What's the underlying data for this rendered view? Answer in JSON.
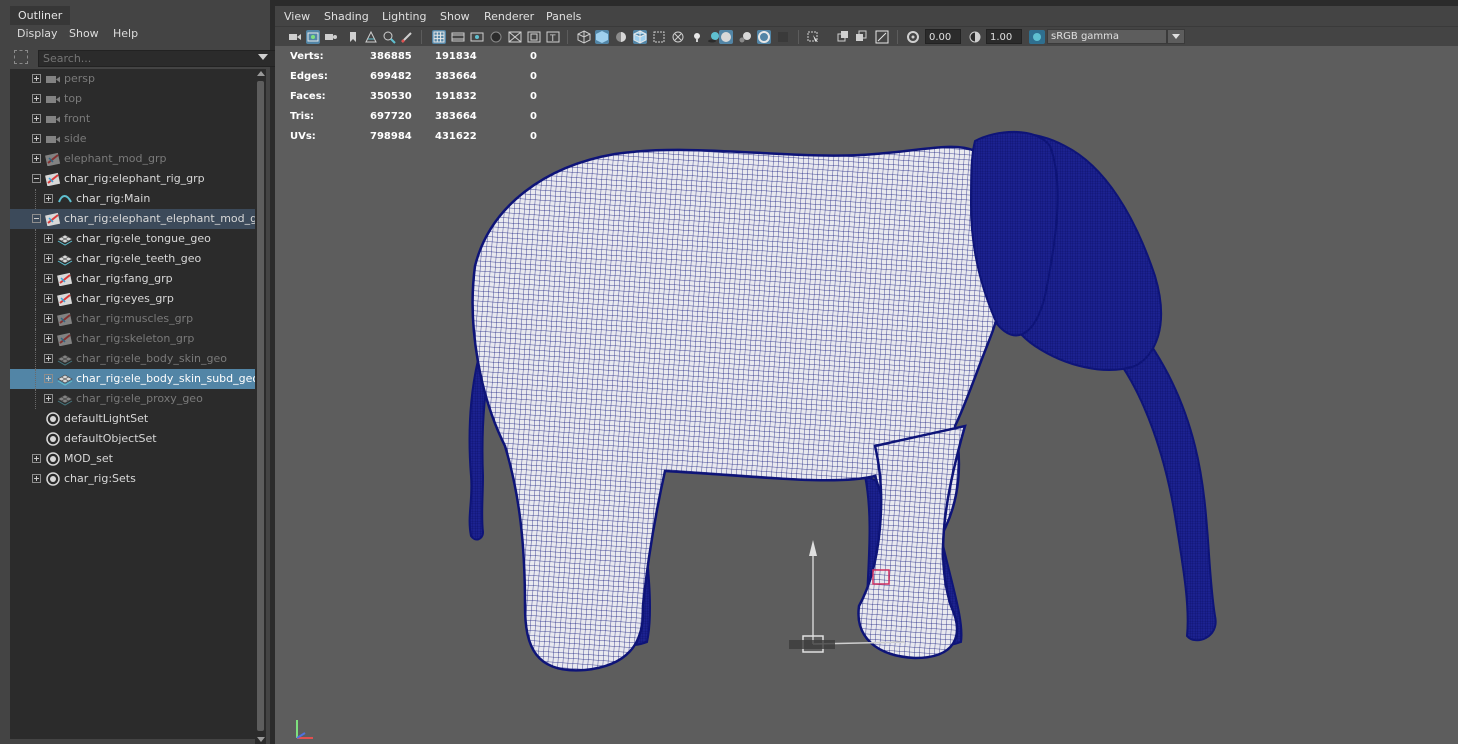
{
  "outliner": {
    "tab_title": "Outliner",
    "menu": [
      "Display",
      "Show",
      "Help"
    ],
    "search_placeholder": "Search...",
    "items": [
      {
        "label": "persp",
        "icon": "camera-icon",
        "state": "dim",
        "expander": "plus",
        "indent": 0
      },
      {
        "label": "top",
        "icon": "camera-icon",
        "state": "dim",
        "expander": "plus",
        "indent": 0
      },
      {
        "label": "front",
        "icon": "camera-icon",
        "state": "dim",
        "expander": "plus",
        "indent": 0
      },
      {
        "label": "side",
        "icon": "camera-icon",
        "state": "dim",
        "expander": "plus",
        "indent": 0
      },
      {
        "label": "elephant_mod_grp",
        "icon": "group-icon",
        "state": "dim",
        "expander": "plus",
        "indent": 0
      },
      {
        "label": "char_rig:elephant_rig_grp",
        "icon": "group-icon",
        "state": "normal",
        "expander": "minus",
        "indent": 0
      },
      {
        "label": "char_rig:Main",
        "icon": "curve-icon",
        "state": "normal",
        "expander": "plus",
        "indent": 1
      },
      {
        "label": "char_rig:elephant_elephant_mod_grp",
        "icon": "group-icon",
        "state": "selected-dark",
        "expander": "minus",
        "indent": 0
      },
      {
        "label": "char_rig:ele_tongue_geo",
        "icon": "mesh-icon",
        "state": "normal",
        "expander": "plus",
        "indent": 1
      },
      {
        "label": "char_rig:ele_teeth_geo",
        "icon": "mesh-icon",
        "state": "normal",
        "expander": "plus",
        "indent": 1
      },
      {
        "label": "char_rig:fang_grp",
        "icon": "group-icon",
        "state": "normal",
        "expander": "plus",
        "indent": 1
      },
      {
        "label": "char_rig:eyes_grp",
        "icon": "group-icon",
        "state": "normal",
        "expander": "plus",
        "indent": 1
      },
      {
        "label": "char_rig:muscles_grp",
        "icon": "group-icon",
        "state": "dim",
        "expander": "plus",
        "indent": 1
      },
      {
        "label": "char_rig:skeleton_grp",
        "icon": "group-icon",
        "state": "dim",
        "expander": "plus",
        "indent": 1
      },
      {
        "label": "char_rig:ele_body_skin_geo",
        "icon": "mesh-icon",
        "state": "dim",
        "expander": "plus",
        "indent": 1
      },
      {
        "label": "char_rig:ele_body_skin_subd_geo",
        "icon": "mesh-icon",
        "state": "selected",
        "expander": "plus",
        "indent": 1
      },
      {
        "label": "char_rig:ele_proxy_geo",
        "icon": "mesh-icon",
        "state": "dim",
        "expander": "plus",
        "indent": 1
      },
      {
        "label": "defaultLightSet",
        "icon": "set-icon",
        "state": "normal",
        "expander": "none",
        "indent": 0
      },
      {
        "label": "defaultObjectSet",
        "icon": "set-icon",
        "state": "normal",
        "expander": "none",
        "indent": 0
      },
      {
        "label": "MOD_set",
        "icon": "set-icon",
        "state": "normal",
        "expander": "plus",
        "indent": 0
      },
      {
        "label": "char_rig:Sets",
        "icon": "set-icon",
        "state": "normal",
        "expander": "plus",
        "indent": 0
      }
    ]
  },
  "viewport": {
    "menu": [
      "View",
      "Shading",
      "Lighting",
      "Show",
      "Renderer",
      "Panels"
    ],
    "toolbar": {
      "exposure_value": "0.00",
      "gamma_value": "1.00",
      "color_space": "sRGB gamma"
    },
    "hud": [
      {
        "label": "Verts:",
        "v1": "386885",
        "v2": "191834",
        "v3": "0"
      },
      {
        "label": "Edges:",
        "v1": "699482",
        "v2": "383664",
        "v3": "0"
      },
      {
        "label": "Faces:",
        "v1": "350530",
        "v2": "191832",
        "v3": "0"
      },
      {
        "label": "Tris:",
        "v1": "697720",
        "v2": "383664",
        "v3": "0"
      },
      {
        "label": "UVs:",
        "v1": "798984",
        "v2": "431622",
        "v3": "0"
      }
    ],
    "colors": {
      "background": "#5d5d5d",
      "wireframe": "#0e1478",
      "mesh_fill": "#e8e8ee",
      "selection_highlight": "#5285a6"
    }
  }
}
